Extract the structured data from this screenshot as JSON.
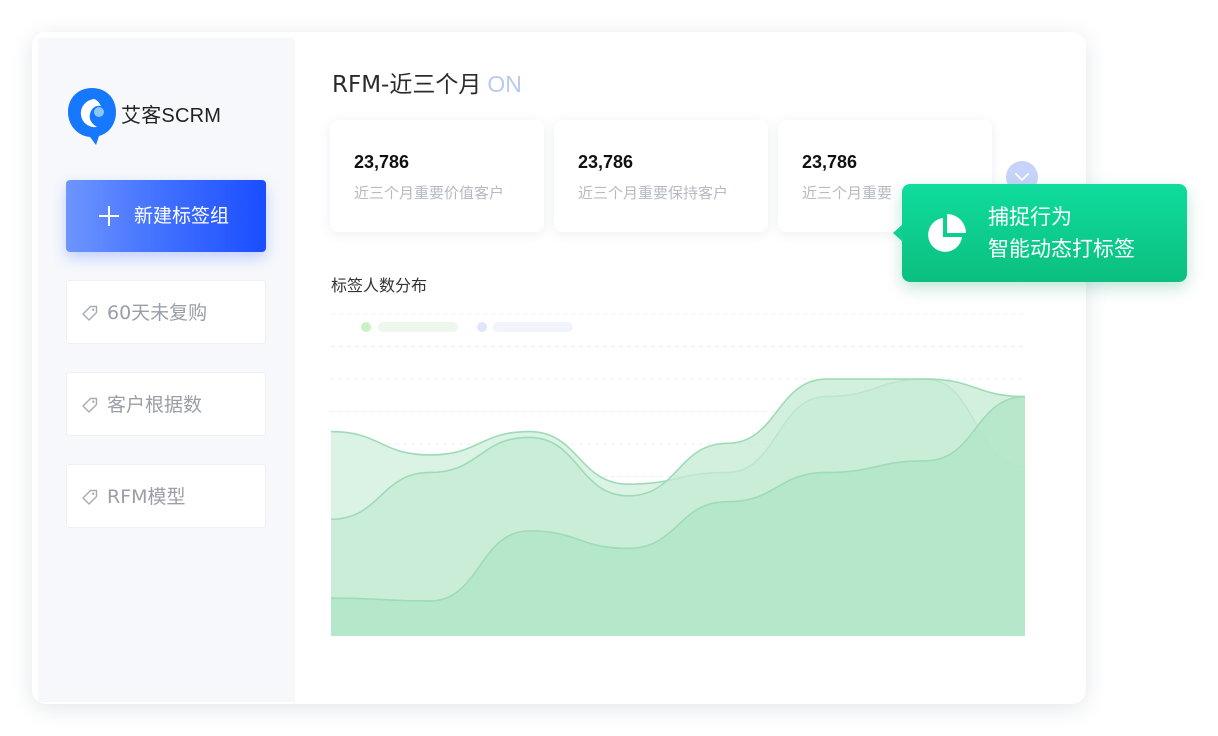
{
  "brand": {
    "name": "艾客SCRM",
    "color": "#1677ff"
  },
  "sidebar": {
    "new_button_label": "新建标签组",
    "items": [
      {
        "label": "60天未复购",
        "icon": "tag-icon"
      },
      {
        "label": "客户根据数",
        "icon": "tag-icon"
      },
      {
        "label": "RFM模型",
        "icon": "tag-icon"
      }
    ]
  },
  "main": {
    "title": "RFM-近三个月",
    "status": "ON",
    "stats": [
      {
        "value": "23,786",
        "label": "近三个月重要价值客户"
      },
      {
        "value": "23,786",
        "label": "近三个月重要保持客户"
      },
      {
        "value": "23,786",
        "label": "近三个月重要"
      }
    ],
    "expand_icon": "chevron-down-icon",
    "chart_title": "标签人数分布"
  },
  "tooltip": {
    "icon": "pie-chart-icon",
    "line1": "捕捉行为",
    "line2": "智能动态打标签"
  },
  "colors": {
    "accent": "#1a4dff",
    "tooltip": "#0fcf8f",
    "area_light": "#d9f2e4",
    "area_mid": "#c4ebd3",
    "area_dark": "#b2e6c8",
    "stroke": "#9edbb6"
  },
  "chart_data": {
    "type": "area",
    "title": "标签人数分布",
    "xlabel": "",
    "ylabel": "",
    "grid": true,
    "legend": "top-left",
    "series": [
      {
        "values": [
          70,
          62,
          70,
          52,
          56,
          82,
          88,
          58
        ]
      },
      {
        "values": [
          40,
          56,
          68,
          48,
          66,
          88,
          88,
          82
        ]
      },
      {
        "values": [
          13,
          12,
          36,
          30,
          46,
          56,
          60,
          82
        ]
      }
    ]
  }
}
